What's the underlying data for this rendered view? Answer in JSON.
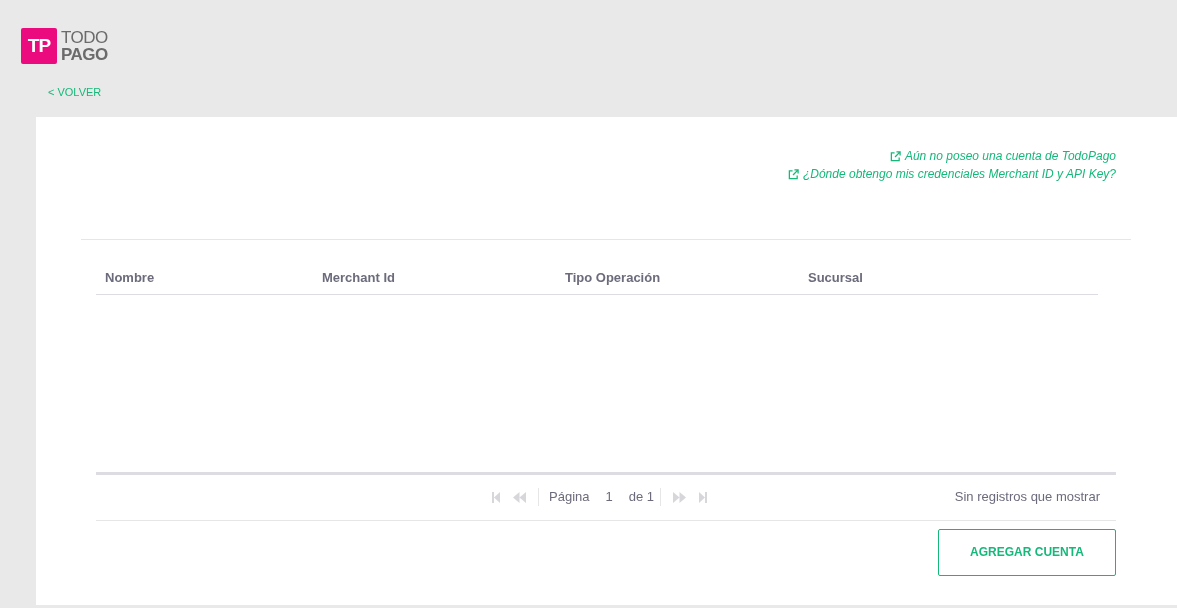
{
  "logo": {
    "mark": "TP",
    "line_1": "TODO",
    "line_2": "PAGO"
  },
  "back_link": "< VOLVER",
  "help_links": [
    "Aún no poseo una cuenta de TodoPago",
    "¿Dónde obtengo mis credenciales Merchant ID y API Key?"
  ],
  "table": {
    "columns": [
      "Nombre",
      "Merchant Id",
      "Tipo Operación",
      "Sucursal"
    ]
  },
  "pager": {
    "nav_buttons": [
      {
        "kind": "first",
        "disabled": true
      },
      {
        "kind": "prev",
        "disabled": true
      },
      {
        "kind": "next",
        "disabled": true
      },
      {
        "kind": "last",
        "disabled": true
      }
    ],
    "page_label": "Página",
    "page_value": "1",
    "of_label": "de 1",
    "status": "Sin registros que mostrar"
  },
  "add_button": "AGREGAR CUENTA"
}
